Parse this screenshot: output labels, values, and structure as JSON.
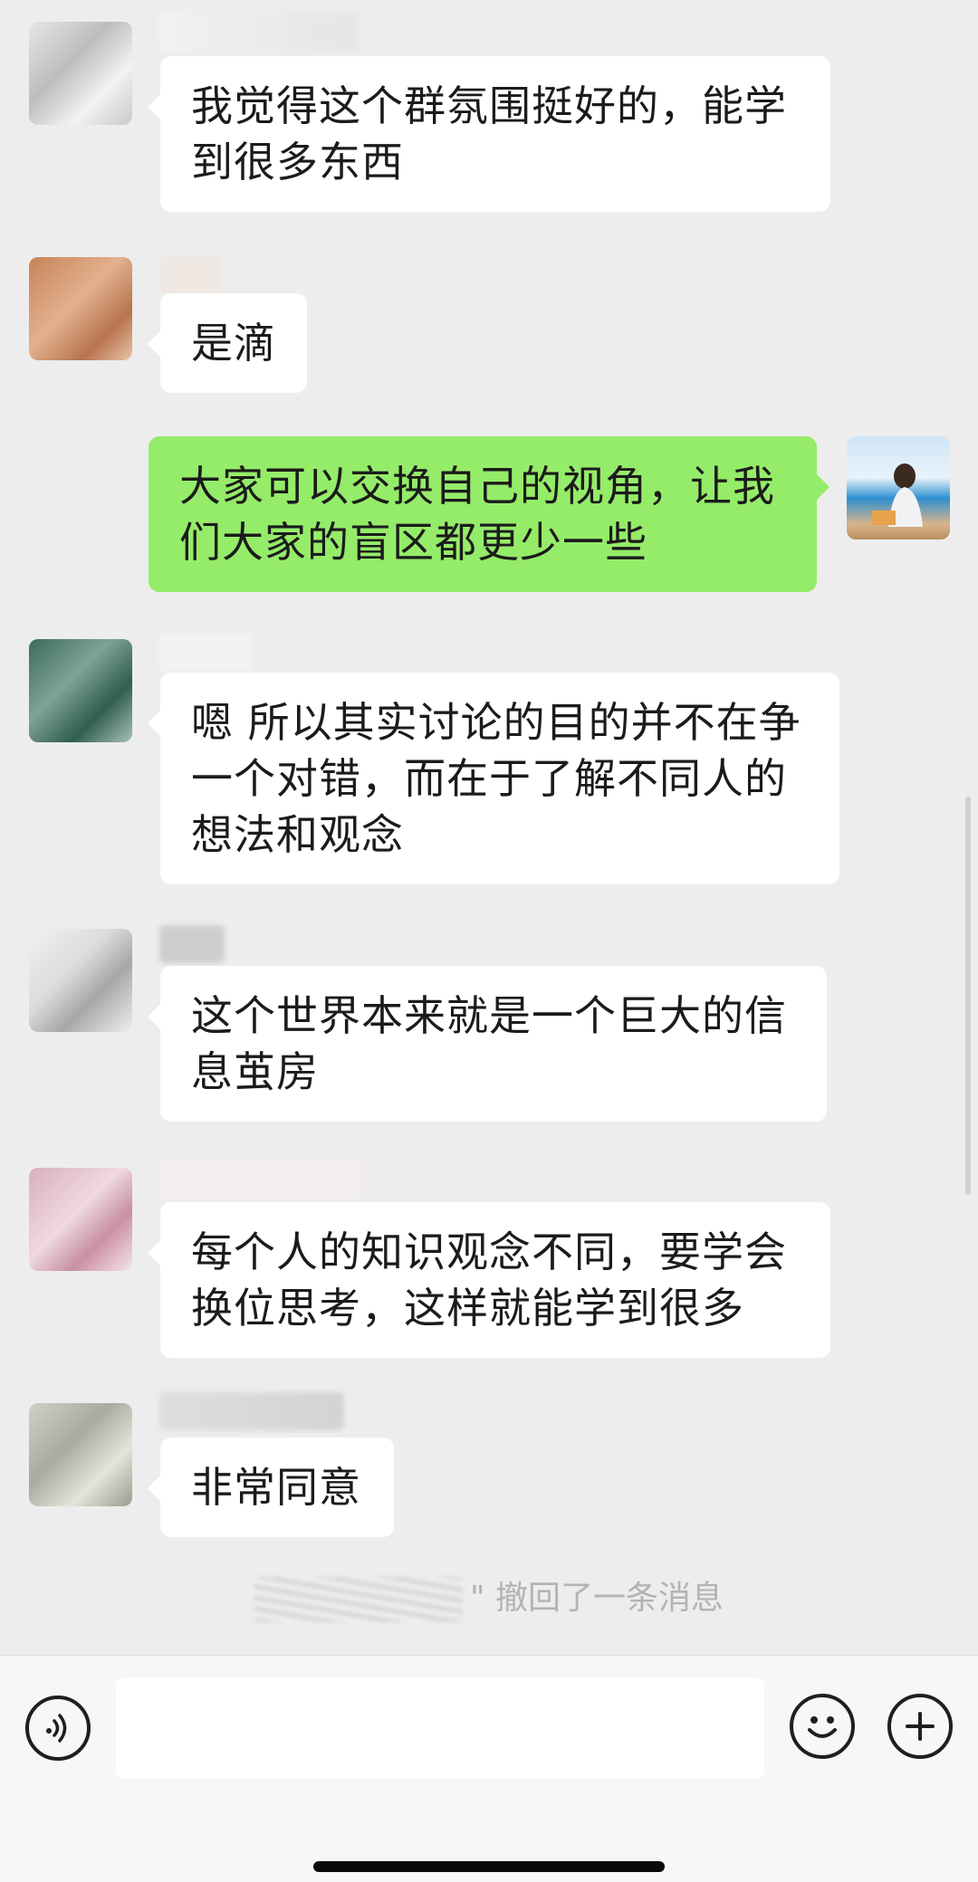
{
  "messages": [
    {
      "side": "left",
      "lines": [
        "我觉得这个群氛围挺好的，能学",
        "到很多东西"
      ]
    },
    {
      "side": "left",
      "lines": [
        "是滴"
      ]
    },
    {
      "side": "right",
      "lines": [
        "大家可以交换自己的视角，让我",
        "们大家的盲区都更少一些"
      ]
    },
    {
      "side": "left",
      "lines": [
        "嗯 所以其实讨论的目的并不在争",
        "一个对错，而在于了解不同人的",
        "想法和观念"
      ]
    },
    {
      "side": "left",
      "lines": [
        "这个世界本来就是一个巨大的信",
        "息茧房"
      ]
    },
    {
      "side": "left",
      "lines": [
        "每个人的知识观念不同，要学会",
        "换位思考，这样就能学到很多"
      ]
    },
    {
      "side": "left",
      "lines": [
        "非常同意"
      ]
    }
  ],
  "system_notice": {
    "text": "\" 撤回了一条消息"
  },
  "input_bar": {
    "voice_icon": "voice-icon",
    "emoji_icon": "emoji-icon",
    "plus_icon": "plus-icon",
    "value": ""
  },
  "colors": {
    "background": "#ededed",
    "bubble_left": "#ffffff",
    "bubble_right": "#95ec69",
    "system_text": "#b3b3b3"
  }
}
